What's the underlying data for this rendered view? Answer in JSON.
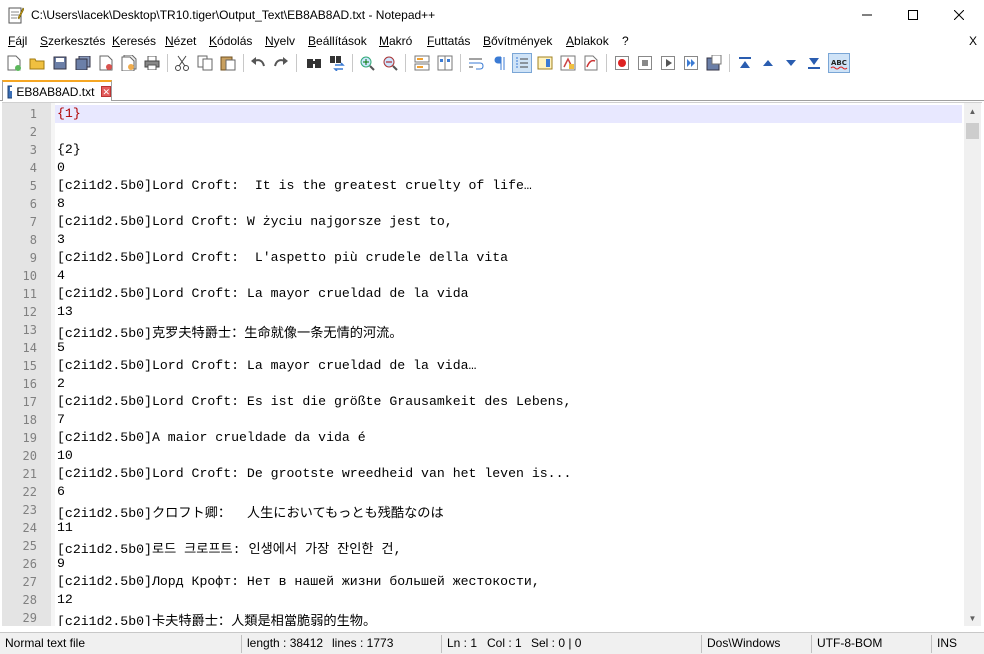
{
  "window": {
    "title": "C:\\Users\\lacek\\Desktop\\TR10.tiger\\Output_Text\\EB8AB8AD.txt - Notepad++",
    "app_icon": "notepad-icon",
    "controls": [
      "minimize-icon",
      "maximize-icon",
      "close-icon"
    ]
  },
  "menu": {
    "items": [
      "Fájl",
      "Szerkesztés",
      "Keresés",
      "Nézet",
      "Kódolás",
      "Nyelv",
      "Beállítások",
      "Makró",
      "Futtatás",
      "Bővítmények",
      "Ablakok",
      "?"
    ],
    "close_doc": "X"
  },
  "toolbar": {
    "buttons": [
      "new-icon",
      "open-icon",
      "save-icon",
      "save-all-icon",
      "close-icon",
      "close-all-icon",
      "print-icon",
      "cut-icon",
      "copy-icon",
      "paste-icon",
      "undo-icon",
      "redo-icon",
      "find-icon",
      "replace-icon",
      "zoom-in-icon",
      "zoom-out-icon",
      "sync-vertical-icon",
      "sync-horizontal-icon",
      "word-wrap-icon",
      "show-all-chars-icon",
      "indent-guide-icon",
      "doc-map-icon",
      "function-list-icon",
      "folder-workspace-icon",
      "record-macro-icon",
      "stop-macro-icon",
      "play-macro-icon",
      "run-macro-multiple-icon",
      "save-macro-icon",
      "prev-bookmark-icon",
      "up-icon",
      "down-icon",
      "next-bookmark-icon",
      "spellcheck-icon"
    ]
  },
  "tab": {
    "label": "EB8AB8AD.txt"
  },
  "editor": {
    "lines": [
      {
        "n": "1",
        "text": "{1}"
      },
      {
        "n": "2",
        "text": ""
      },
      {
        "n": "3",
        "text": "{2}"
      },
      {
        "n": "4",
        "text": "0"
      },
      {
        "n": "5",
        "text": "[c2i1d2.5b0]Lord Croft:  It is the greatest cruelty of life…"
      },
      {
        "n": "6",
        "text": "8"
      },
      {
        "n": "7",
        "text": "[c2i1d2.5b0]Lord Croft: W życiu najgorsze jest to,"
      },
      {
        "n": "8",
        "text": "3"
      },
      {
        "n": "9",
        "text": "[c2i1d2.5b0]Lord Croft:  L'aspetto più crudele della vita"
      },
      {
        "n": "10",
        "text": "4"
      },
      {
        "n": "11",
        "text": "[c2i1d2.5b0]Lord Croft: La mayor crueldad de la vida"
      },
      {
        "n": "12",
        "text": "13"
      },
      {
        "n": "13",
        "text": "[c2i1d2.5b0]克罗夫特爵士：生命就像一条无情的河流。"
      },
      {
        "n": "14",
        "text": "5"
      },
      {
        "n": "15",
        "text": "[c2i1d2.5b0]Lord Croft: La mayor crueldad de la vida…"
      },
      {
        "n": "16",
        "text": "2"
      },
      {
        "n": "17",
        "text": "[c2i1d2.5b0]Lord Croft: Es ist die größte Grausamkeit des Lebens,"
      },
      {
        "n": "18",
        "text": "7"
      },
      {
        "n": "19",
        "text": "[c2i1d2.5b0]A maior crueldade da vida é"
      },
      {
        "n": "20",
        "text": "10"
      },
      {
        "n": "21",
        "text": "[c2i1d2.5b0]Lord Croft: De grootste wreedheid van het leven is..."
      },
      {
        "n": "22",
        "text": "6"
      },
      {
        "n": "23",
        "text": "[c2i1d2.5b0]クロフト卿：  人生においてもっとも残酷なのは"
      },
      {
        "n": "24",
        "text": "11"
      },
      {
        "n": "25",
        "text": "[c2i1d2.5b0]로드 크로프트: 인생에서 가장 잔인한 건,"
      },
      {
        "n": "26",
        "text": "9"
      },
      {
        "n": "27",
        "text": "[c2i1d2.5b0]Лорд Крофт: Нет в нашей жизни большей жестокости,"
      },
      {
        "n": "28",
        "text": "12"
      },
      {
        "n": "29",
        "text": "[c2i1d2.5b0]卡夫特爵士：人類是相當脆弱的生物。"
      }
    ]
  },
  "status": {
    "file_type": "Normal text file",
    "length": "length : 38412",
    "lines": "lines : 1773",
    "ln": "Ln : 1",
    "col": "Col : 1",
    "sel": "Sel : 0 | 0",
    "eol": "Dos\\Windows",
    "encoding": "UTF-8-BOM",
    "mode": "INS"
  },
  "colors": {
    "current_line": "#e8e8ff",
    "gutter": "#e4e4e4",
    "brace_highlight": "#b00000",
    "tab_accent": "#f5a623"
  }
}
